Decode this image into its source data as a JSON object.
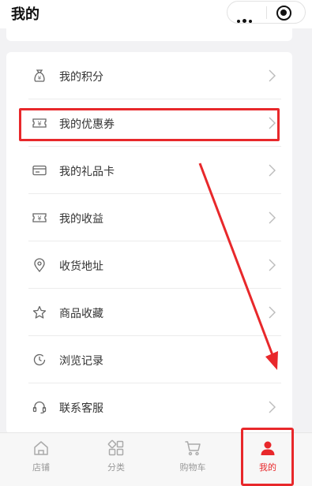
{
  "header": {
    "title": "我的"
  },
  "menu": {
    "items": [
      {
        "label": "我的积分",
        "icon": "points-bag-icon"
      },
      {
        "label": "我的优惠券",
        "icon": "coupon-icon"
      },
      {
        "label": "我的礼品卡",
        "icon": "gift-card-icon"
      },
      {
        "label": "我的收益",
        "icon": "earnings-icon"
      },
      {
        "label": "收货地址",
        "icon": "location-pin-icon"
      },
      {
        "label": "商品收藏",
        "icon": "star-icon"
      },
      {
        "label": "浏览记录",
        "icon": "history-clock-icon"
      },
      {
        "label": "联系客服",
        "icon": "headset-icon"
      }
    ]
  },
  "tabbar": {
    "tabs": [
      {
        "label": "店铺",
        "icon": "store-home-icon"
      },
      {
        "label": "分类",
        "icon": "category-grid-icon"
      },
      {
        "label": "购物车",
        "icon": "cart-icon"
      },
      {
        "label": "我的",
        "icon": "profile-person-icon"
      }
    ],
    "active_color": "#e8282b",
    "inactive_color": "#999999"
  },
  "annotation_color": "#e8282b"
}
